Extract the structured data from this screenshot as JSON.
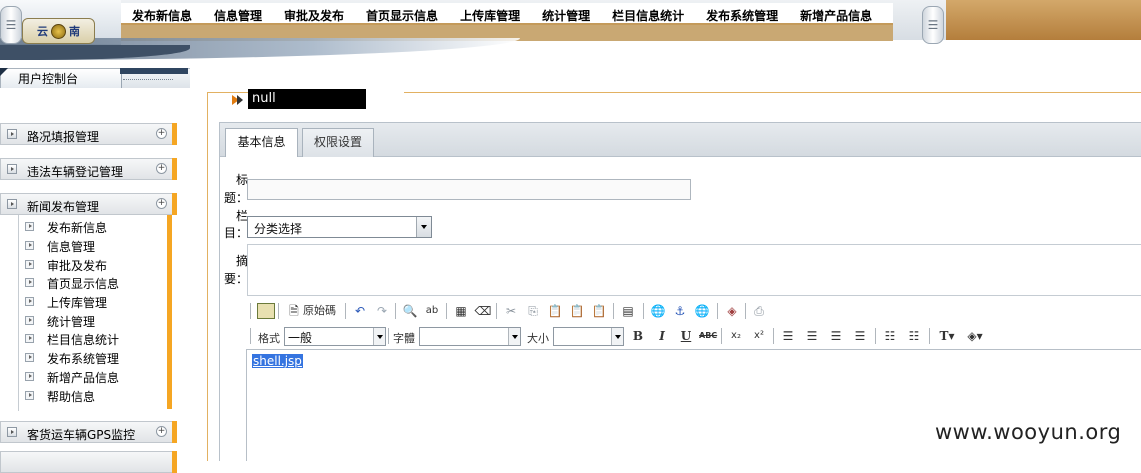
{
  "header": {
    "logo_text_left": "云",
    "logo_text_right": "南",
    "menu": [
      "发布新信息",
      "信息管理",
      "审批及发布",
      "首页显示信息",
      "上传库管理",
      "统计管理",
      "栏目信息统计",
      "发布系统管理",
      "新增产品信息"
    ]
  },
  "sidebar": {
    "console_label": "用户控制台",
    "groups": [
      {
        "label": "路况填报管理"
      },
      {
        "label": "违法车辆登记管理"
      },
      {
        "label": "新闻发布管理"
      },
      {
        "label": "客货运车辆GPS监控"
      }
    ],
    "news_sub_items": [
      "发布新信息",
      "信息管理",
      "审批及发布",
      "首页显示信息",
      "上传库管理",
      "统计管理",
      "栏目信息统计",
      "发布系统管理",
      "新增产品信息",
      "帮助信息"
    ]
  },
  "main": {
    "page_title": "null",
    "tabs": [
      {
        "label": "基本信息",
        "active": true
      },
      {
        "label": "权限设置",
        "active": false
      }
    ],
    "form": {
      "title_label_1": "标",
      "title_label_2": "题：",
      "title_value": "",
      "category_label_1": "栏",
      "category_label_2": "目：",
      "category_value": "分类选择",
      "summary_label_1": "摘",
      "summary_label_2": "要：",
      "summary_value": ""
    },
    "editor": {
      "source_label": "原始碼",
      "format_label": "格式",
      "format_value": "一般",
      "font_label": "字體",
      "font_value": "",
      "size_label": "大小",
      "size_value": "",
      "content": "shell.jsp"
    }
  },
  "watermark": "www.wooyun.org",
  "colors": {
    "accent_orange": "#f5a623",
    "frame_line": "#e2b162",
    "selection_blue": "#3574e0"
  }
}
